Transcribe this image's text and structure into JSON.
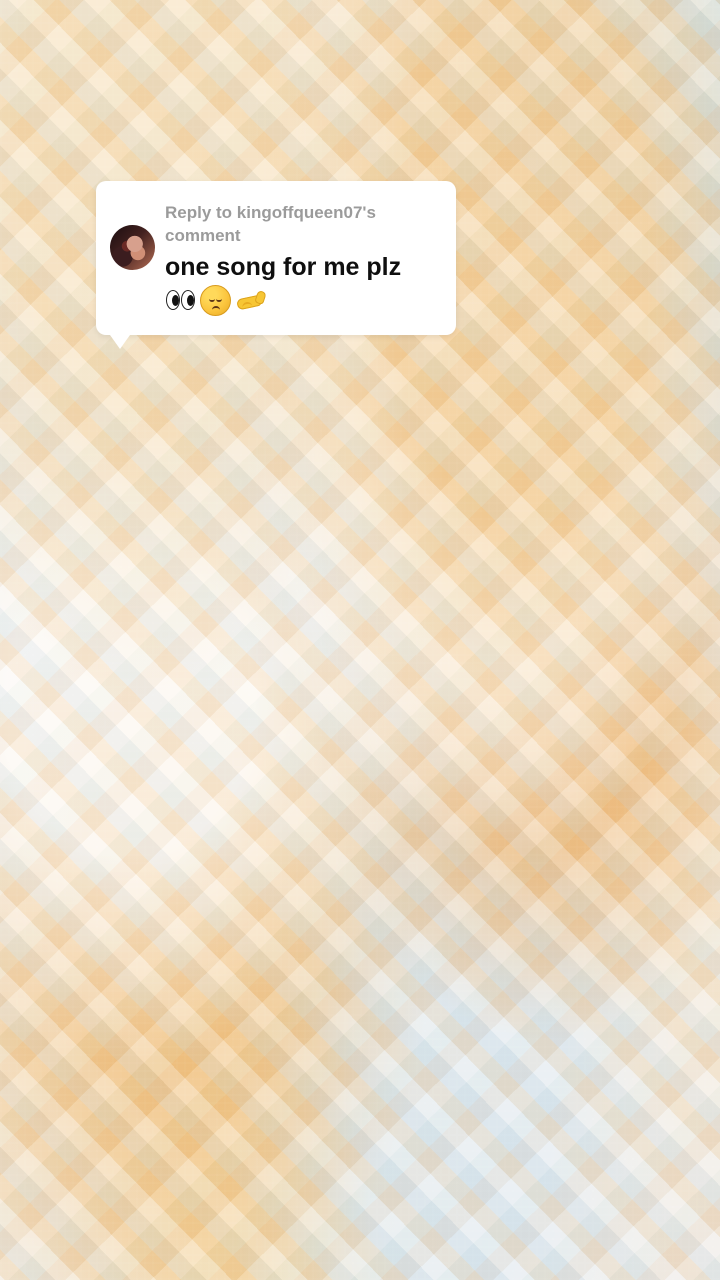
{
  "background": {
    "description_colors": {
      "cream": "#ece7df",
      "amber": "#f1b062",
      "soft_blue": "#dbe6ee"
    }
  },
  "reply_bubble": {
    "reply_prefix": "Reply to kingoffqueen07's comment",
    "comment": "one song for me plz",
    "emojis": [
      "eyes-icon",
      "pensive-face-icon",
      "flexed-biceps-icon"
    ]
  }
}
